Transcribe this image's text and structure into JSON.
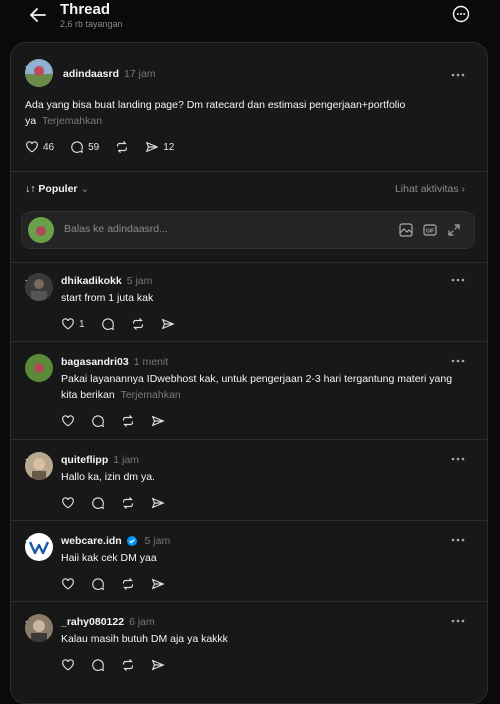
{
  "header": {
    "title": "Thread",
    "views": "2,6 rb tayangan"
  },
  "main_post": {
    "username": "adindaasrd",
    "time": "17 jam",
    "text": "Ada yang bisa buat landing page? Dm ratecard dan estimasi pengerjaan+portfolio ya",
    "translate": "Terjemahkan",
    "likes": "46",
    "comments": "59",
    "shares": "12"
  },
  "sort": {
    "label": "Populer",
    "activity": "Lihat aktivitas"
  },
  "reply_box": {
    "placeholder": "Balas ke adindaasrd..."
  },
  "replies": [
    {
      "username": "dhikadikokk",
      "time": "5 jam",
      "text": "start from 1 juta kak",
      "likes": "1"
    },
    {
      "username": "bagasandri03",
      "time": "1 menit",
      "text": "Pakai layanannya IDwebhost kak, untuk pengerjaan 2-3 hari tergantung materi yang kita berikan",
      "translate": "Terjemahkan"
    },
    {
      "username": "quiteflipp",
      "time": "1 jam",
      "text": "Hallo ka, izin dm ya."
    },
    {
      "username": "webcare.idn",
      "time": "5 jam",
      "text": "Haii kak cek DM yaa",
      "verified": true
    },
    {
      "username": "_rahy080122",
      "time": "6 jam",
      "text": "Kalau masih butuh DM aja ya kakkk"
    }
  ],
  "colors": {
    "background": "#0a0a0a",
    "panel": "#181818",
    "verified": "#0095f6",
    "muted": "#8a8a8a"
  }
}
